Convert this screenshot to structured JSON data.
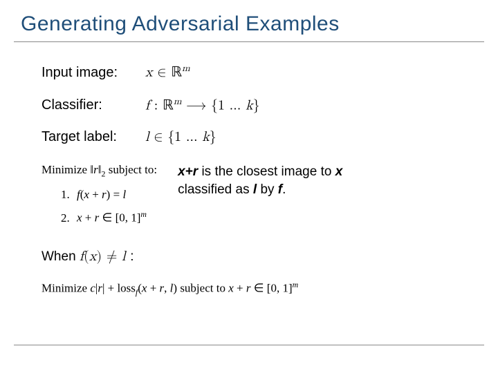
{
  "title": "Generating Adversarial Examples",
  "rows": {
    "input_label": "Input image:",
    "input_math": "x ∈ ℝᵐ",
    "classifier_label": "Classifier:",
    "classifier_math": "f : ℝᵐ ⟶ {1 … k}",
    "target_label": "Target label:",
    "target_math": "l ∈ {1 … k}"
  },
  "opt": {
    "minimize": "Minimize ‖r‖₂ subject to:",
    "c1_num": "1.",
    "c1": "f(x + r) = l",
    "c2_num": "2.",
    "c2": "x + r ∈ [0, 1]ᵐ"
  },
  "explain": {
    "pre": "x+r",
    "mid1": " is the closest image to ",
    "x": "x",
    "mid2": " classified as ",
    "l": "l",
    "mid3": " by ",
    "f": "f",
    "end": "."
  },
  "when": {
    "label": "When ",
    "math": "f(x) ≠ l",
    "colon": " :"
  },
  "final": "Minimize c|r| + loss_f(x + r, l) subject to x + r ∈ [0, 1]ᵐ"
}
